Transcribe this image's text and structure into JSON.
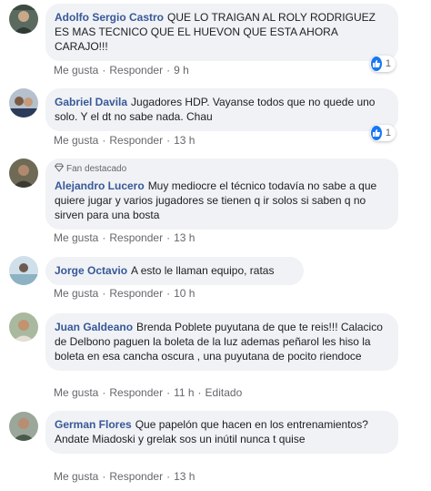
{
  "actions": {
    "like": "Me gusta",
    "reply": "Responder",
    "separator": "·"
  },
  "comments": [
    {
      "author": "Adolfo Sergio Castro",
      "text": "QUE LO TRAIGAN AL ROLY RODRIGUEZ ES MAS TECNICO QUE EL HUEVON QUE ESTA AHORA CARAJO!!!",
      "time": "9 h",
      "reactions": "1"
    },
    {
      "author": "Gabriel Davila",
      "text": "Jugadores HDP. Vayanse todos que no quede uno solo. Y el dt no sabe nada. Chau",
      "time": "13 h",
      "reactions": "1"
    },
    {
      "badge": "Fan destacado",
      "author": "Alejandro Lucero",
      "text": "Muy mediocre el técnico todavía no sabe a que quiere jugar y varios jugadores se tienen q ir solos si saben q no sirven para una bosta",
      "time": "13 h"
    },
    {
      "author": "Jorge Octavio",
      "text": "A esto le llaman equipo, ratas",
      "time": "10 h"
    },
    {
      "author": "Juan Galdeano",
      "text": "Brenda Poblete puyutana de que te reis!!! Calacico de Delbono paguen la boleta de la luz ademas peñarol les hiso la boleta en esa cancha oscura , una puyutana de pocito riendoce",
      "time": "11 h",
      "edited": "Editado"
    },
    {
      "author": "German Flores",
      "text": "Que papelón que hacen en los entrenamientos? Andate Miadoski y grelak sos un inútil nunca t quise",
      "time": "13 h"
    }
  ]
}
